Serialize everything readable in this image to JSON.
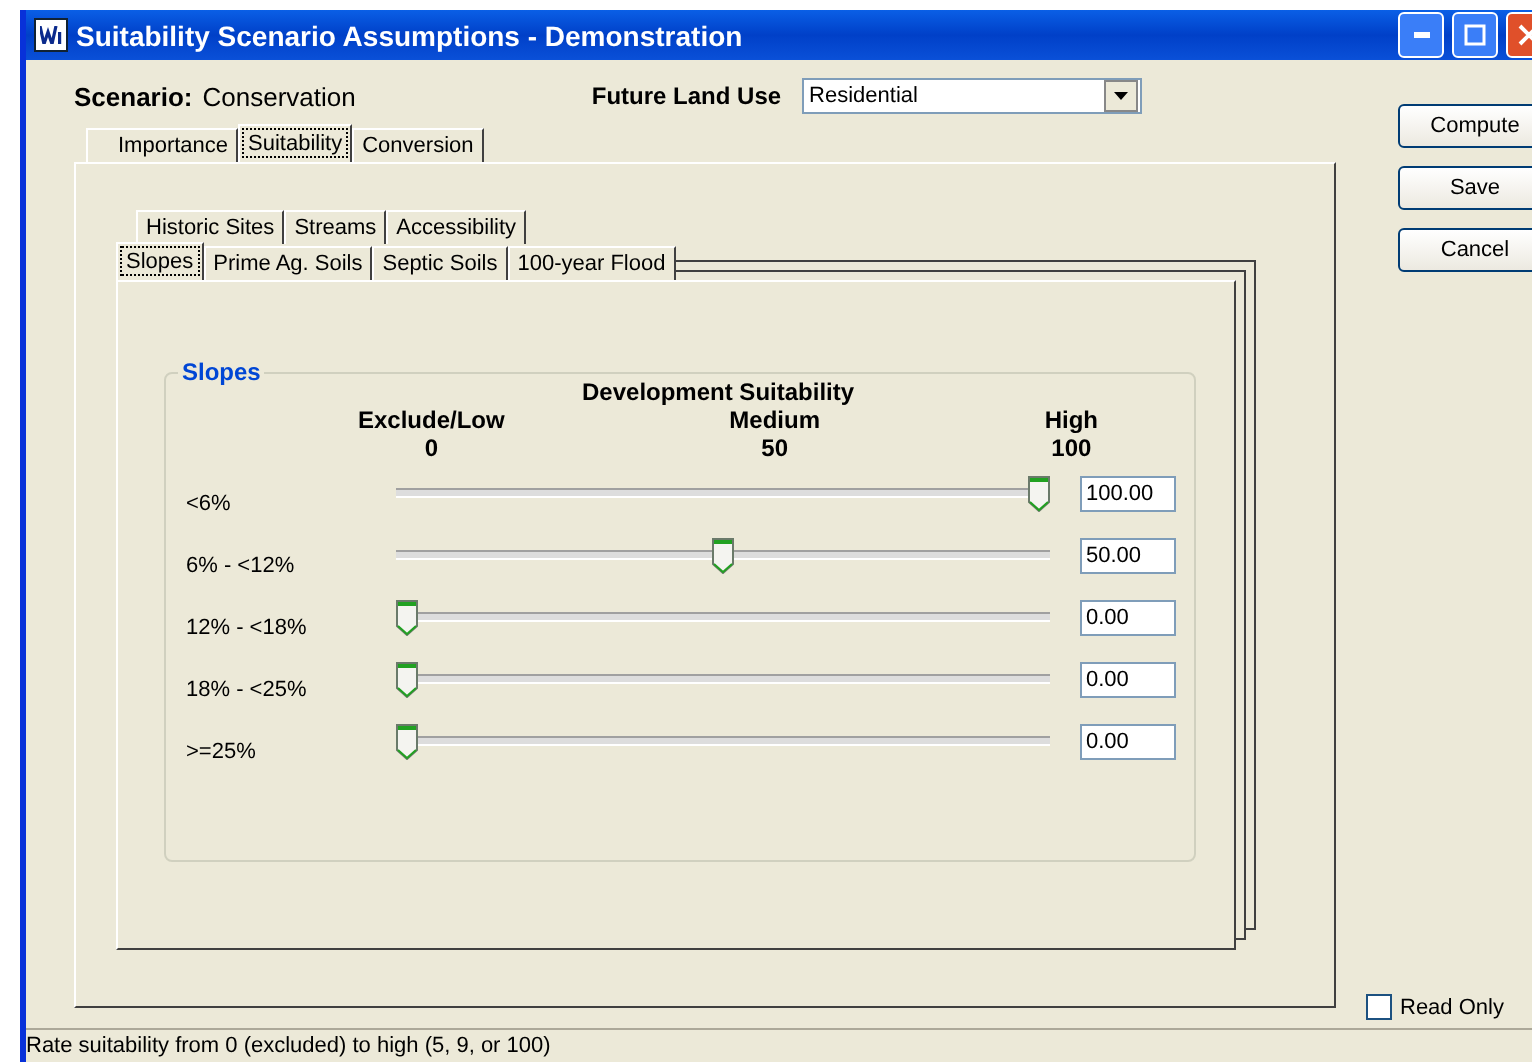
{
  "window": {
    "title": "Suitability Scenario Assumptions - Demonstration"
  },
  "scenario": {
    "label": "Scenario:",
    "value": "Conservation"
  },
  "future_land_use": {
    "label": "Future Land Use",
    "value": "Residential"
  },
  "tabs": [
    {
      "label": "Importance",
      "selected": false
    },
    {
      "label": "Suitability",
      "selected": true
    },
    {
      "label": "Conversion",
      "selected": false
    }
  ],
  "sub_tab_rows": [
    [
      {
        "label": "Historic Sites",
        "selected": false
      },
      {
        "label": "Streams",
        "selected": false
      },
      {
        "label": "Accessibility",
        "selected": false
      }
    ],
    [
      {
        "label": "Slopes",
        "selected": true
      },
      {
        "label": "Prime Ag. Soils",
        "selected": false
      },
      {
        "label": "Septic Soils",
        "selected": false
      },
      {
        "label": "100-year Flood",
        "selected": false
      }
    ]
  ],
  "group": {
    "title": "Slopes",
    "heading": "Development Suitability",
    "scale": [
      {
        "label": "Exclude/Low",
        "value": "0"
      },
      {
        "label": "Medium",
        "value": "50"
      },
      {
        "label": "High",
        "value": "100"
      }
    ],
    "rows": [
      {
        "label": "<6%",
        "level": 1,
        "value": "100.00"
      },
      {
        "label": "6% - <12%",
        "level": 0.5,
        "value": "50.00"
      },
      {
        "label": "12% - <18%",
        "level": 0,
        "value": "0.00"
      },
      {
        "label": "18% - <25%",
        "level": 0,
        "value": "0.00"
      },
      {
        "label": ">=25%",
        "level": 0,
        "value": "0.00"
      }
    ]
  },
  "buttons": [
    "Compute",
    "Save",
    "Cancel"
  ],
  "read_only": {
    "label": "Read Only",
    "checked": false
  },
  "status_bar": "Rate suitability from 0 (excluded) to high (5, 9, or 100)"
}
